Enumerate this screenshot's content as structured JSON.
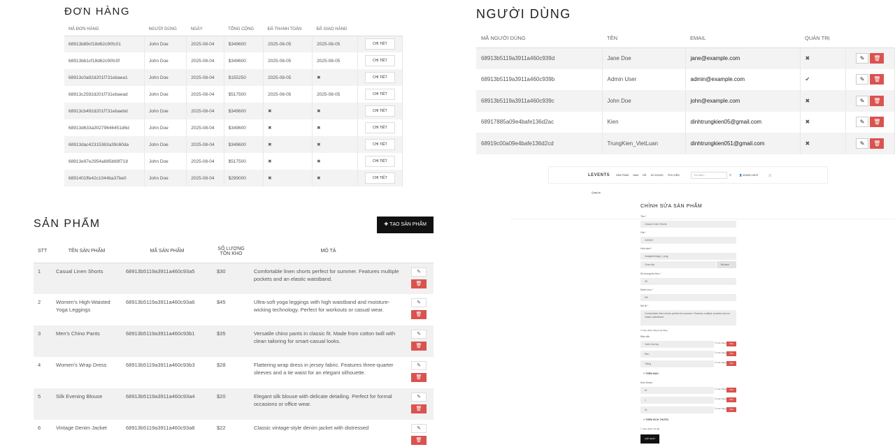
{
  "orders": {
    "title": "ĐƠN HÀNG",
    "headers": [
      "MÃ ĐƠN HÀNG",
      "NGƯỜI DÙNG",
      "NGÀY",
      "TỔNG CỘNG",
      "ĐÃ THANH TOÁN",
      "ĐÃ GIAO HÀNG",
      ""
    ],
    "detail_label": "CHI TIẾT",
    "rows": [
      {
        "id": "68913b89cf18d62c90fc01",
        "user": "John Doe",
        "date": "2025-08-04",
        "total": "$349600",
        "paid": "2025-08-05",
        "delivered": "2025-08-05"
      },
      {
        "id": "68913bb1cf18d62c90fc0f",
        "user": "John Doe",
        "date": "2025-08-04",
        "total": "$349600",
        "paid": "2025-08-05",
        "delivered": "2025-08-05"
      },
      {
        "id": "68913c0a92d201f731ebaea1",
        "user": "John Doe",
        "date": "2025-08-04",
        "total": "$155250",
        "paid": "2025-08-05",
        "delivered": "✖"
      },
      {
        "id": "68913c2592d201f731ebaead",
        "user": "John Doe",
        "date": "2025-08-04",
        "total": "$517500",
        "paid": "2025-08-05",
        "delivered": "2025-08-05"
      },
      {
        "id": "68913cb492d201f731ebaebd",
        "user": "John Doe",
        "date": "2025-08-04",
        "total": "$349600",
        "paid": "✖",
        "delivered": "✖"
      },
      {
        "id": "68913d633a30279646451d6d",
        "user": "John Doe",
        "date": "2025-08-04",
        "total": "$349600",
        "paid": "✖",
        "delivered": "✖"
      },
      {
        "id": "68913dac42315363a39c60da",
        "user": "John Doe",
        "date": "2025-08-04",
        "total": "$349600",
        "paid": "✖",
        "delivered": "✖"
      },
      {
        "id": "68913e97e2954a685b69f718",
        "user": "John Doe",
        "date": "2025-08-04",
        "total": "$517500",
        "paid": "✖",
        "delivered": "✖"
      },
      {
        "id": "6891401ffe42c1044ba37be0",
        "user": "John Doe",
        "date": "2025-08-04",
        "total": "$299000",
        "paid": "✖",
        "delivered": "✖"
      }
    ]
  },
  "users": {
    "title": "NGƯỜI DÙNG",
    "headers": [
      "MÃ NGƯỜI DÙNG",
      "TÊN",
      "EMAIL",
      "QUẢN TRỊ",
      ""
    ],
    "rows": [
      {
        "id": "68913b5119a3911a460c939d",
        "name": "Jane Doe",
        "email": "jane@example.com",
        "admin": "✖"
      },
      {
        "id": "68913b5119a3911a460c939b",
        "name": "Admin User",
        "email": "admin@example.com",
        "admin": "✔"
      },
      {
        "id": "68913b5119a3911a460c939c",
        "name": "John Doe",
        "email": "john@example.com",
        "admin": "✖"
      },
      {
        "id": "68917885a09e4bafe136d2ac",
        "name": "Kien",
        "email": "dinhtrungkien05@gmail.com",
        "admin": "✖"
      },
      {
        "id": "68919c00a09e4bafe136d2cd",
        "name": "TrungKien_VietLuan",
        "email": "dinhtrungkien051@gmail.com",
        "admin": "✖"
      }
    ]
  },
  "products": {
    "title": "SẢN PHẨM",
    "create_label": "TẠO SẢN PHẨM",
    "headers": [
      "STT",
      "TÊN SẢN PHẨM",
      "MÃ SẢN PHẨM",
      "SỐ LƯỢNG TỒN KHO",
      "MÔ TẢ",
      ""
    ],
    "rows": [
      {
        "stt": "1",
        "name": "Casual Linen Shorts",
        "id": "68913b5119a3911a460c93a5",
        "stock": "$30",
        "desc": "Comfortable linen shorts perfect for summer. Features multiple pockets and an elastic waistband."
      },
      {
        "stt": "2",
        "name": "Women's High-Waisted Yoga Leggings",
        "id": "68913b5119a3911a460c93a6",
        "stock": "$45",
        "desc": "Ultra-soft yoga leggings with high waistband and moisture-wicking technology. Perfect for workouts or casual wear."
      },
      {
        "stt": "3",
        "name": "Men's Chino Pants",
        "id": "68913b5119a3911a460c93b1",
        "stock": "$35",
        "desc": "Versatile chino pants in classic fit. Made from cotton twill with clean tailoring for smart-casual looks."
      },
      {
        "stt": "4",
        "name": "Women's Wrap Dress",
        "id": "68913b5119a3911a460c93b3",
        "stock": "$28",
        "desc": "Flattering wrap dress in jersey fabric. Features three-quarter sleeves and a tie waist for an elegant silhouette."
      },
      {
        "stt": "5",
        "name": "Silk Evening Blouse",
        "id": "68913b5119a3911a460c93a4",
        "stock": "$20",
        "desc": "Elegant silk blouse with delicate detailing. Perfect for formal occasions or office wear."
      },
      {
        "stt": "6",
        "name": "Vintage Denim Jacket",
        "id": "68913b5119a3911a460c93a8",
        "stock": "$22",
        "desc": "Classic vintage-style denim jacket with distressed"
      }
    ]
  },
  "mini": {
    "brand": "LEVENTS",
    "nav": [
      "SẢN PHẨM",
      "NAM",
      "NỮ",
      "ÁO KHOÁC",
      "PHỤ KIỆN"
    ],
    "search_placeholder": "Tìm kiếm...",
    "user_label": "ADMIN USER",
    "back_label": "Quay lại",
    "title": "CHỈNH SỬA SẢN PHẨM",
    "labels": {
      "name": "Tên *",
      "price": "Giá *",
      "image": "Hình ảnh *",
      "stock": "Số lượng tồn kho *",
      "category": "Danh mục *",
      "desc": "Mô tả *",
      "active": "Sản phẩm đang hoạt động",
      "colors": "Màu sắc",
      "sizes": "Kích thước",
      "featured": "Sản phẩm nổi bật",
      "submit": "CẬP NHẬT",
      "add_color": "+ THÊM MÀU",
      "add_size": "+ THÊM KÍCH THƯỚC"
    },
    "values": {
      "name": "Casual Linen Shorts",
      "price": "240000",
      "image": "/images/image_1.png",
      "file": "Chọn tệp",
      "browse": "Browse",
      "stock": "30",
      "category": "Nữ",
      "desc": "Comfortable linen shorts perfect for summer. Features multiple pockets and an elastic waistband."
    },
    "colors": [
      "Xanh dương",
      "Đen",
      "Trắng"
    ],
    "sizes": [
      "M",
      "L",
      "XL"
    ],
    "stock_label": "Còn hàng",
    "remove_label": "Xóa"
  },
  "colors": {
    "danger": "#d9534f",
    "accent": "#111111"
  }
}
